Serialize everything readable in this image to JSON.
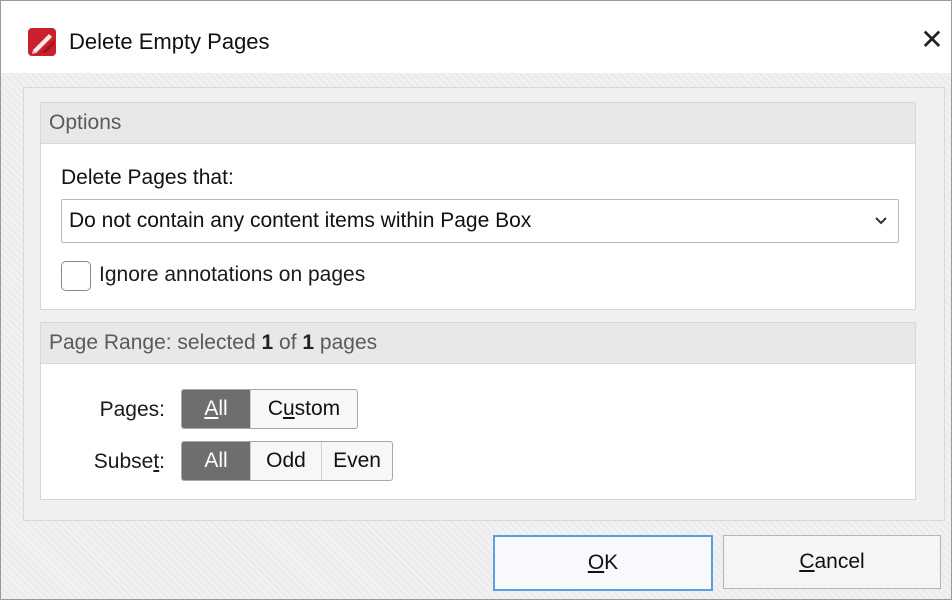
{
  "window": {
    "title": "Delete Empty Pages",
    "close_glyph": "✕",
    "icon": "pdf-editor-app-icon"
  },
  "options": {
    "header": "Options",
    "delete_label": "Delete Pages that:",
    "delete_select_value": "Do not contain any content items within Page Box",
    "ignore_annotations_label": "Ignore annotations on pages",
    "ignore_annotations_checked": false
  },
  "page_range": {
    "header_prefix": "Page Range: selected",
    "selected": "1",
    "of_word": "of",
    "total": "1",
    "pages_word": "pages",
    "pages_label_pre": "Pa",
    "pages_label_ul": "g",
    "pages_label_post": "es:",
    "pages_options": {
      "all_ul": "A",
      "all_rest": "ll",
      "custom_pre": "C",
      "custom_ul": "u",
      "custom_post": "stom"
    },
    "pages_selected": "All",
    "subset_label_pre": "Subse",
    "subset_label_ul": "t",
    "subset_label_post": ":",
    "subset_options": [
      "All",
      "Odd",
      "Even"
    ],
    "subset_selected": "All"
  },
  "buttons": {
    "ok_ul": "O",
    "ok_rest": "K",
    "cancel_ul": "C",
    "cancel_rest": "ancel"
  },
  "colors": {
    "accent_border": "#5aa0e0",
    "segment_selected": "#6e6e6e",
    "icon_red": "#c8202c"
  }
}
